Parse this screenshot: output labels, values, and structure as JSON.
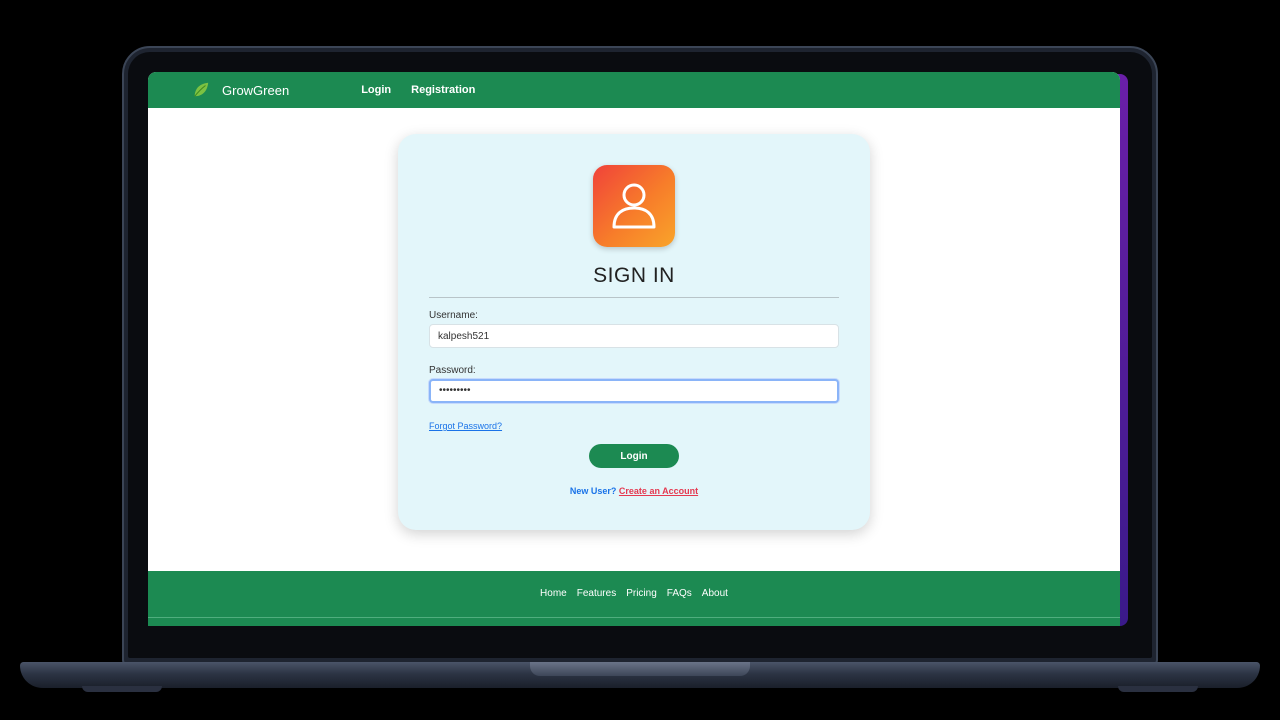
{
  "brand": {
    "name": "GrowGreen",
    "icon": "leaf-icon",
    "color": "#1c8a52"
  },
  "nav": {
    "items": [
      {
        "label": "Login"
      },
      {
        "label": "Registration"
      }
    ]
  },
  "signin": {
    "avatar_icon": "user-icon",
    "title": "SIGN IN",
    "username_label": "Username:",
    "username_value": "kalpesh521",
    "password_label": "Password:",
    "password_value": "•••••••••",
    "forgot_label": "Forgot Password?",
    "login_label": "Login",
    "new_user_label": "New User?",
    "create_account_label": "Create an Account"
  },
  "footer": {
    "links": [
      {
        "label": "Home"
      },
      {
        "label": "Features"
      },
      {
        "label": "Pricing"
      },
      {
        "label": "FAQs"
      },
      {
        "label": "About"
      }
    ]
  },
  "colors": {
    "accent": "#1c8a52",
    "card_bg": "#e3f6fa",
    "link_blue": "#1a73e8",
    "link_red": "#e53950"
  }
}
